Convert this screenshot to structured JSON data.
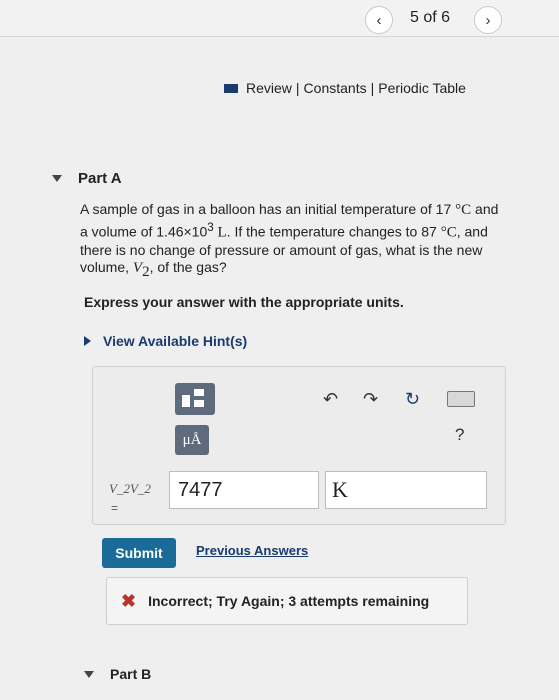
{
  "nav": {
    "prev_icon": "‹",
    "next_icon": "›",
    "counter": "5 of 6"
  },
  "links": {
    "review": "Review",
    "constants": "Constants",
    "periodic_table": "Periodic Table",
    "separator": "|"
  },
  "part_a": {
    "title": "Part A"
  },
  "question": {
    "t1": "A sample of gas in a balloon has an initial temperature of 17 ",
    "u1": "°C",
    "t2": " and a volume of 1.46×10",
    "exp": "3",
    "u2": " L",
    "t3": ". If the temperature changes to 87 ",
    "u3": "°C",
    "t4": ", and there is no change of pressure or amount of gas, what is the new volume, ",
    "var_main": "V",
    "var_sub": "2",
    "t5": ", of the gas?"
  },
  "instruction": "Express your answer with the appropriate units.",
  "hints": {
    "label": "View Available Hint(s)"
  },
  "toolbar": {
    "units_label": "μÅ",
    "help": "?"
  },
  "answer": {
    "var_label": "V_2V_2",
    "equals": "=",
    "value": "7477",
    "unit": "K"
  },
  "actions": {
    "submit": "Submit",
    "previous_answers": "Previous Answers"
  },
  "feedback": {
    "icon": "✖",
    "text": "Incorrect; Try Again; 3 attempts remaining"
  },
  "part_b": {
    "title": "Part B"
  },
  "colors": {
    "brand": "#1a3b6e",
    "submit": "#1a6b98",
    "error": "#c0302b"
  }
}
